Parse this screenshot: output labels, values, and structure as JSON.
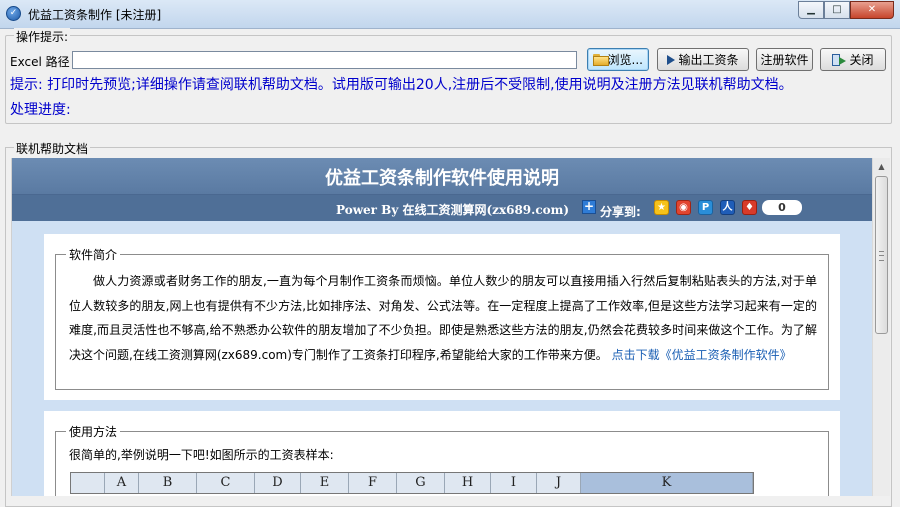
{
  "window": {
    "title": "优益工资条制作 [未注册]",
    "controls": {
      "minimize": "▁",
      "maximize": "□",
      "close": "✕"
    }
  },
  "ops": {
    "legend": "操作提示:",
    "excel_path_label": "Excel 路径",
    "excel_path_value": "",
    "browse_label": "浏览...",
    "export_label": "输出工资条",
    "register_label": "注册软件",
    "close_label": "关闭",
    "hint": "提示: 打印时先预览;详细操作请查阅联机帮助文档。试用版可输出20人,注册后不受限制,使用说明及注册方法见联机帮助文档。",
    "progress_label": "处理进度:"
  },
  "help": {
    "legend": "联机帮助文档",
    "doc_title": "优益工资条制作软件使用说明",
    "power_by": "Power By 在线工资测算网(zx689.com)",
    "share_label": "分享到:",
    "share_count": "0",
    "intro": {
      "legend": "软件简介",
      "text": "做人力资源或者财务工作的朋友,一直为每个月制作工资条而烦恼。单位人数少的朋友可以直接用插入行然后复制粘贴表头的方法,对于单位人数较多的朋友,网上也有提供有不少方法,比如排序法、对角发、公式法等。在一定程度上提高了工作效率,但是这些方法学习起来有一定的难度,而且灵活性也不够高,给不熟悉办公软件的朋友增加了不少负担。即使是熟悉这些方法的朋友,仍然会花费较多时间来做这个工作。为了解决这个问题,在线工资测算网(zx689.com)专门制作了工资条打印程序,希望能给大家的工作带来方便。",
      "link": "点击下载《优益工资条制作软件》"
    },
    "usage": {
      "legend": "使用方法",
      "text": "很简单的,举例说明一下吧!如图所示的工资表样本:",
      "columns": [
        "",
        "A",
        "B",
        "C",
        "D",
        "E",
        "F",
        "G",
        "H",
        "I",
        "J",
        "K"
      ]
    }
  },
  "colors": {
    "hint_text": "#0000cc",
    "doc_header_bg": "#5e7fa6",
    "content_bg": "#cfe0f3",
    "link": "#1a5fb4"
  },
  "icons": {
    "app": "app-icon",
    "browse": "folder-icon",
    "export": "play-icon",
    "close": "exit-icon",
    "share": [
      "plus-icon",
      "qzone-icon",
      "weibo-icon",
      "qq-weibo-icon",
      "renren-icon",
      "kaixin-icon"
    ]
  }
}
